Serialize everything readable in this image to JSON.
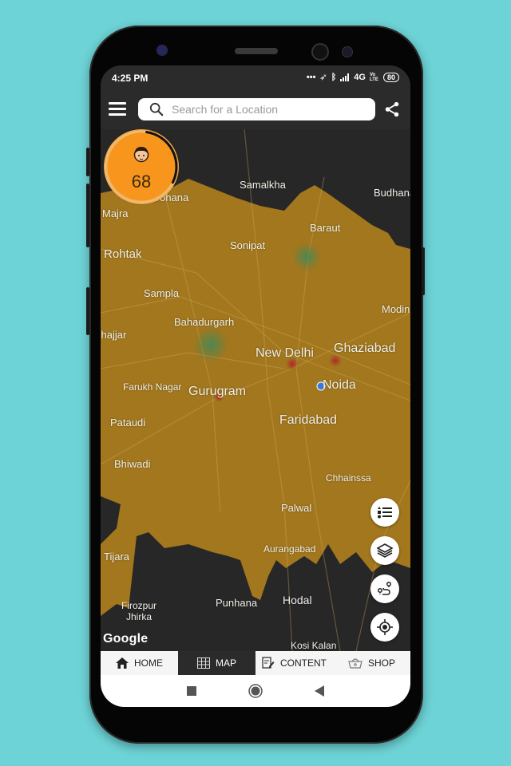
{
  "status_bar": {
    "time": "4:25 PM",
    "network": "4G",
    "volte": "Vo LTE",
    "battery": "80"
  },
  "header": {
    "search_placeholder": "Search for a Location",
    "search_value": ""
  },
  "aqi_badge": {
    "value": "68",
    "ring_progress": 0.3,
    "color": "#f7951d"
  },
  "map": {
    "attribution": "Google",
    "overlay_color": "#a97b1e",
    "base_color": "#272727",
    "cities": [
      {
        "name": "Samalkha",
        "size": "normal"
      },
      {
        "name": "Budhana",
        "size": "normal"
      },
      {
        "name": "Gohana",
        "size": "normal"
      },
      {
        "name": "Majra",
        "size": "normal"
      },
      {
        "name": "Baraut",
        "size": "normal"
      },
      {
        "name": "Sonipat",
        "size": "normal"
      },
      {
        "name": "Rohtak",
        "size": "big"
      },
      {
        "name": "Sampla",
        "size": "normal"
      },
      {
        "name": "Modinagar",
        "size": "normal"
      },
      {
        "name": "Bahadurgarh",
        "size": "normal"
      },
      {
        "name": "Jhajjar",
        "size": "normal"
      },
      {
        "name": "New Delhi",
        "size": "big"
      },
      {
        "name": "Ghaziabad",
        "size": "big"
      },
      {
        "name": "Farukh Nagar",
        "size": "normal"
      },
      {
        "name": "Gurugram",
        "size": "big"
      },
      {
        "name": "Noida",
        "size": "big"
      },
      {
        "name": "Pataudi",
        "size": "normal"
      },
      {
        "name": "Faridabad",
        "size": "big"
      },
      {
        "name": "Bhiwadi",
        "size": "normal"
      },
      {
        "name": "Chhainssa",
        "size": "normal"
      },
      {
        "name": "Palwal",
        "size": "normal"
      },
      {
        "name": "Tijara",
        "size": "normal"
      },
      {
        "name": "Aurangabad",
        "size": "normal"
      },
      {
        "name": "Firozpur Jhirka",
        "size": "normal"
      },
      {
        "name": "Punhana",
        "size": "normal"
      },
      {
        "name": "Hodal",
        "size": "normal"
      },
      {
        "name": "Kosi Kalan",
        "size": "normal"
      }
    ]
  },
  "fabs": [
    {
      "name": "legend",
      "icon": "list-icon"
    },
    {
      "name": "layers",
      "icon": "layers-icon"
    },
    {
      "name": "route",
      "icon": "route-icon"
    },
    {
      "name": "my-location",
      "icon": "crosshair-icon"
    }
  ],
  "tabs": [
    {
      "label": "HOME",
      "icon": "home-icon",
      "active": false
    },
    {
      "label": "MAP",
      "icon": "map-grid-icon",
      "active": true
    },
    {
      "label": "CONTENT",
      "icon": "edit-document-icon",
      "active": false
    },
    {
      "label": "SHOP",
      "icon": "basket-icon",
      "active": false
    }
  ]
}
